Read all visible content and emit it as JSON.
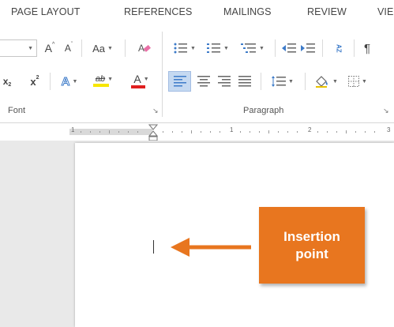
{
  "ribbon_tabs": [
    {
      "label": "PAGE LAYOUT"
    },
    {
      "label": "REFERENCES"
    },
    {
      "label": "MAILINGS"
    },
    {
      "label": "REVIEW"
    },
    {
      "label": "VIE"
    }
  ],
  "font_group": {
    "label": "Font",
    "grow_font": "A",
    "shrink_font": "A",
    "change_case": "Aa",
    "subscript": "x",
    "superscript": "x",
    "text_effects": "A",
    "highlight": "ab",
    "font_color": "A"
  },
  "paragraph_group": {
    "label": "Paragraph",
    "sort": "AZ",
    "pilcrow": "¶"
  },
  "ruler": {
    "numbers": [
      "1",
      "1",
      "2",
      "3"
    ]
  },
  "callout": {
    "line1": "Insertion",
    "line2": "point"
  },
  "colors": {
    "accent_orange": "#e8761f",
    "highlight_yellow": "#f7e600",
    "font_red": "#e02020",
    "active_blue": "#c5d9f1"
  }
}
